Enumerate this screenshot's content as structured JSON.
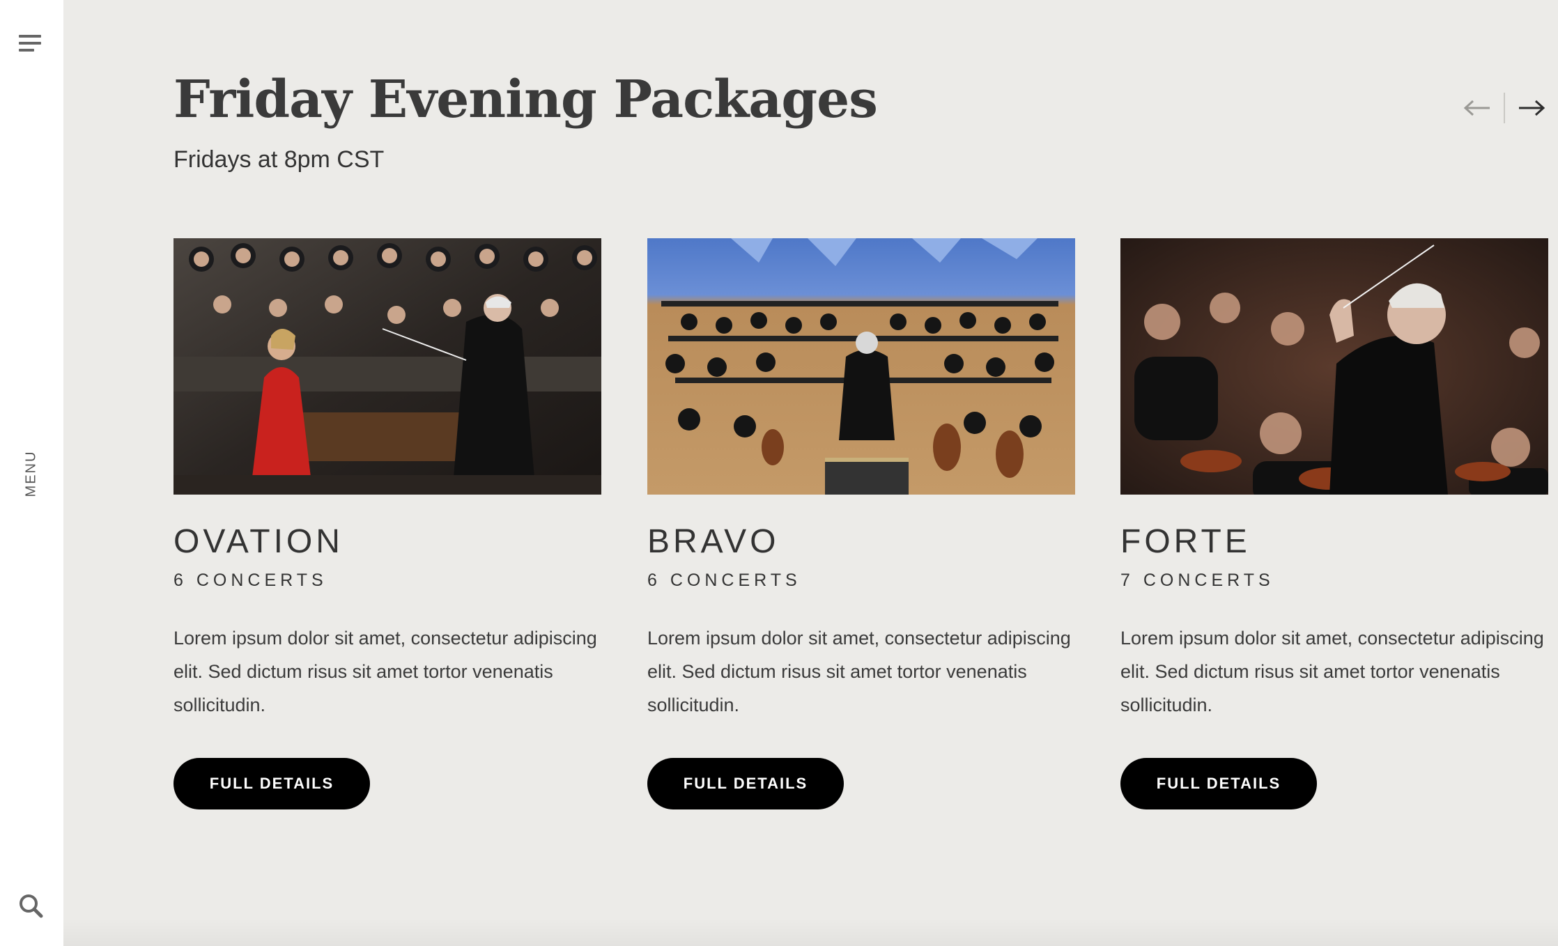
{
  "sidebar": {
    "menu_label": "MENU",
    "icons": [
      "hamburger-icon",
      "search-icon"
    ]
  },
  "header": {
    "title": "Friday Evening Packages",
    "subtitle": "Fridays at 8pm CST"
  },
  "carousel": {
    "prev_icon": "arrow-left-icon",
    "next_icon": "arrow-right-icon"
  },
  "packages": [
    {
      "name": "OVATION",
      "concerts": "6 CONCERTS",
      "description": "Lorem ipsum dolor sit amet, consectetur adipiscing elit. Sed dictum risus sit amet tortor venenatis sollicitudin.",
      "button_label": "FULL DETAILS",
      "image": "photo: violinist in red dress performing with conductor and orchestra"
    },
    {
      "name": "BRAVO",
      "concerts": "6 CONCERTS",
      "description": "Lorem ipsum dolor sit amet, consectetur adipiscing elit. Sed dictum risus sit amet tortor venenatis sollicitudin.",
      "button_label": "FULL DETAILS",
      "image": "photo: overhead view of conductor leading full orchestra on stage"
    },
    {
      "name": "FORTE",
      "concerts": "7 CONCERTS",
      "description": "Lorem ipsum dolor sit amet, consectetur adipiscing elit. Sed dictum risus sit amet tortor venenatis sollicitudin.",
      "button_label": "FULL DETAILS",
      "image": "photo: conductor gesturing with baton in front of string section"
    }
  ],
  "colors": {
    "page_background": "#ecebe8",
    "sidebar_background": "#ffffff",
    "button_background": "#000000",
    "button_text": "#ffffff"
  }
}
